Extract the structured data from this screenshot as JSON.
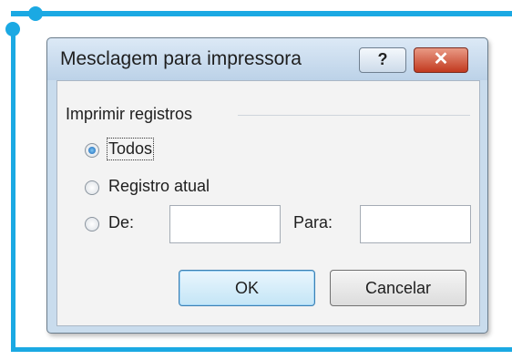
{
  "dialog": {
    "title": "Mesclagem para impressora",
    "help_label": "?",
    "close_label": "✕",
    "group_label": "Imprimir registros",
    "options": [
      {
        "label": "Todos",
        "checked": true
      },
      {
        "label": "Registro atual",
        "checked": false
      },
      {
        "label": "De:",
        "checked": false
      }
    ],
    "from_value": "",
    "to_label": "Para:",
    "to_value": "",
    "ok_label": "OK",
    "cancel_label": "Cancelar"
  },
  "colors": {
    "frame": "#1ba9e3",
    "titlebar": "#c9dced",
    "close_button": "#c2391f"
  }
}
